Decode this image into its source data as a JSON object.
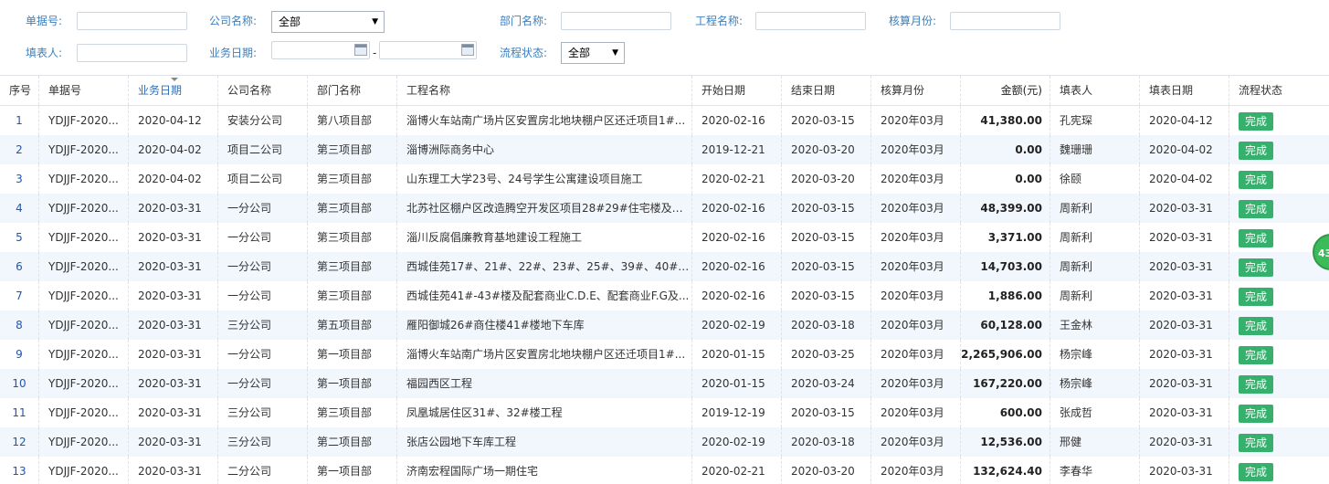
{
  "form": {
    "doc_no_label": "单据号:",
    "company_label": "公司名称:",
    "company_value": "全部",
    "dept_label": "部门名称:",
    "project_label": "工程名称:",
    "month_label": "核算月份:",
    "filler_label": "填表人:",
    "bizdate_label": "业务日期:",
    "date_sep": "-",
    "flow_label": "流程状态:",
    "flow_value": "全部"
  },
  "grid": {
    "headers": [
      "序号",
      "单据号",
      "业务日期",
      "公司名称",
      "部门名称",
      "工程名称",
      "开始日期",
      "结束日期",
      "核算月份",
      "金额(元)",
      "填表人",
      "填表日期",
      "流程状态"
    ],
    "rows": [
      {
        "no": "1",
        "doc": "YDJJF-2020...",
        "bizdate": "2020-04-12",
        "company": "安装分公司",
        "dept": "第八项目部",
        "project": "淄博火车站南广场片区安置房北地块棚户区还迁项目1#...",
        "start": "2020-02-16",
        "end": "2020-03-15",
        "month": "2020年03月",
        "amount": "41,380.00",
        "filler": "孔宪琛",
        "filldate": "2020-04-12",
        "status": "完成"
      },
      {
        "no": "2",
        "doc": "YDJJF-2020...",
        "bizdate": "2020-04-02",
        "company": "项目二公司",
        "dept": "第三项目部",
        "project": "淄博洲际商务中心",
        "start": "2019-12-21",
        "end": "2020-03-20",
        "month": "2020年03月",
        "amount": "0.00",
        "filler": "魏珊珊",
        "filldate": "2020-04-02",
        "status": "完成"
      },
      {
        "no": "3",
        "doc": "YDJJF-2020...",
        "bizdate": "2020-04-02",
        "company": "项目二公司",
        "dept": "第三项目部",
        "project": "山东理工大学23号、24号学生公寓建设项目施工",
        "start": "2020-02-21",
        "end": "2020-03-20",
        "month": "2020年03月",
        "amount": "0.00",
        "filler": "徐颐",
        "filldate": "2020-04-02",
        "status": "完成"
      },
      {
        "no": "4",
        "doc": "YDJJF-2020...",
        "bizdate": "2020-03-31",
        "company": "一分公司",
        "dept": "第三项目部",
        "project": "北苏社区棚户区改造腾空开发区项目28#29#住宅楼及商...",
        "start": "2020-02-16",
        "end": "2020-03-15",
        "month": "2020年03月",
        "amount": "48,399.00",
        "filler": "周新利",
        "filldate": "2020-03-31",
        "status": "完成"
      },
      {
        "no": "5",
        "doc": "YDJJF-2020...",
        "bizdate": "2020-03-31",
        "company": "一分公司",
        "dept": "第三项目部",
        "project": "淄川反腐倡廉教育基地建设工程施工",
        "start": "2020-02-16",
        "end": "2020-03-15",
        "month": "2020年03月",
        "amount": "3,371.00",
        "filler": "周新利",
        "filldate": "2020-03-31",
        "status": "完成"
      },
      {
        "no": "6",
        "doc": "YDJJF-2020...",
        "bizdate": "2020-03-31",
        "company": "一分公司",
        "dept": "第三项目部",
        "project": "西城佳苑17#、21#、22#、23#、25#、39#、40#住宅...",
        "start": "2020-02-16",
        "end": "2020-03-15",
        "month": "2020年03月",
        "amount": "14,703.00",
        "filler": "周新利",
        "filldate": "2020-03-31",
        "status": "完成"
      },
      {
        "no": "7",
        "doc": "YDJJF-2020...",
        "bizdate": "2020-03-31",
        "company": "一分公司",
        "dept": "第三项目部",
        "project": "西城佳苑41#-43#楼及配套商业C.D.E、配套商业F.G及...",
        "start": "2020-02-16",
        "end": "2020-03-15",
        "month": "2020年03月",
        "amount": "1,886.00",
        "filler": "周新利",
        "filldate": "2020-03-31",
        "status": "完成"
      },
      {
        "no": "8",
        "doc": "YDJJF-2020...",
        "bizdate": "2020-03-31",
        "company": "三分公司",
        "dept": "第五项目部",
        "project": "雁阳御城26#商住楼41#楼地下车库",
        "start": "2020-02-19",
        "end": "2020-03-18",
        "month": "2020年03月",
        "amount": "60,128.00",
        "filler": "王金林",
        "filldate": "2020-03-31",
        "status": "完成"
      },
      {
        "no": "9",
        "doc": "YDJJF-2020...",
        "bizdate": "2020-03-31",
        "company": "一分公司",
        "dept": "第一项目部",
        "project": "淄博火车站南广场片区安置房北地块棚户区还迁项目1#...",
        "start": "2020-01-15",
        "end": "2020-03-25",
        "month": "2020年03月",
        "amount": "2,265,906.00",
        "filler": "杨宗峰",
        "filldate": "2020-03-31",
        "status": "完成"
      },
      {
        "no": "10",
        "doc": "YDJJF-2020...",
        "bizdate": "2020-03-31",
        "company": "一分公司",
        "dept": "第一项目部",
        "project": "福园西区工程",
        "start": "2020-01-15",
        "end": "2020-03-24",
        "month": "2020年03月",
        "amount": "167,220.00",
        "filler": "杨宗峰",
        "filldate": "2020-03-31",
        "status": "完成"
      },
      {
        "no": "11",
        "doc": "YDJJF-2020...",
        "bizdate": "2020-03-31",
        "company": "三分公司",
        "dept": "第三项目部",
        "project": "凤凰城居住区31#、32#楼工程",
        "start": "2019-12-19",
        "end": "2020-03-15",
        "month": "2020年03月",
        "amount": "600.00",
        "filler": "张成哲",
        "filldate": "2020-03-31",
        "status": "完成"
      },
      {
        "no": "12",
        "doc": "YDJJF-2020...",
        "bizdate": "2020-03-31",
        "company": "三分公司",
        "dept": "第二项目部",
        "project": "张店公园地下车库工程",
        "start": "2020-02-19",
        "end": "2020-03-18",
        "month": "2020年03月",
        "amount": "12,536.00",
        "filler": "邢健",
        "filldate": "2020-03-31",
        "status": "完成"
      },
      {
        "no": "13",
        "doc": "YDJJF-2020...",
        "bizdate": "2020-03-31",
        "company": "二分公司",
        "dept": "第一项目部",
        "project": "济南宏程国际广场一期住宅",
        "start": "2020-02-21",
        "end": "2020-03-20",
        "month": "2020年03月",
        "amount": "132,624.40",
        "filler": "李春华",
        "filldate": "2020-03-31",
        "status": "完成"
      }
    ]
  },
  "float_badge": "43"
}
